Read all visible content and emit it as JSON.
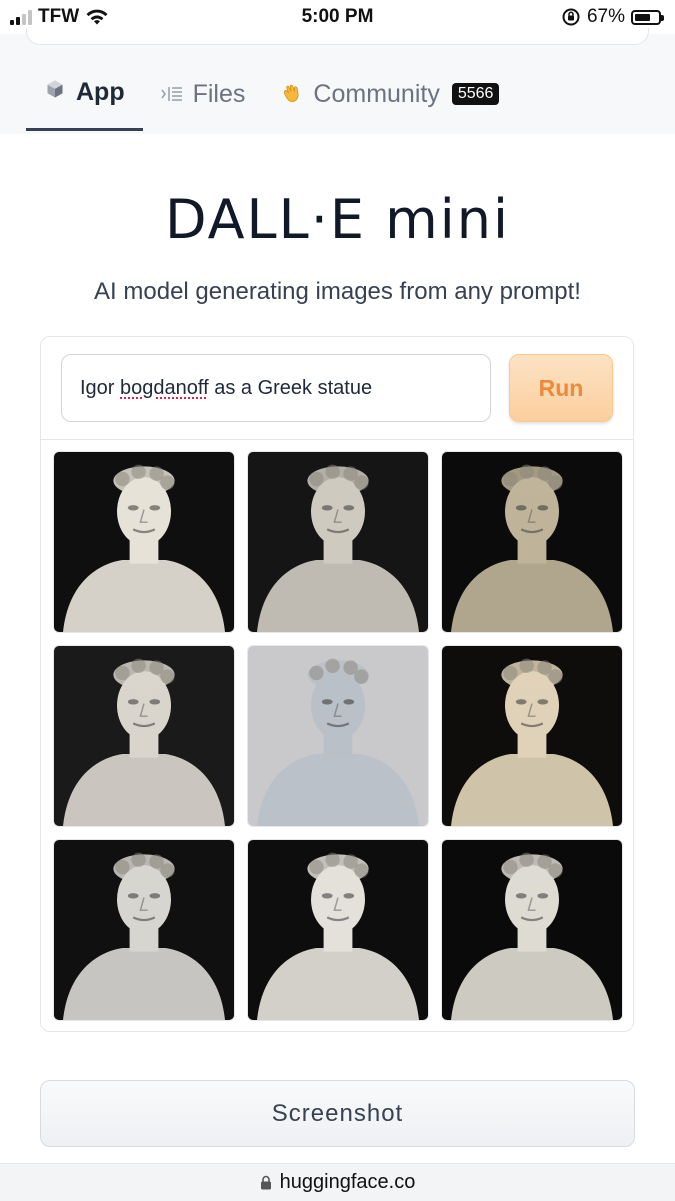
{
  "status_bar": {
    "carrier": "TFW",
    "time": "5:00 PM",
    "battery_percent_label": "67%",
    "battery_level": 0.67
  },
  "tabs": [
    {
      "label": "App",
      "icon": "cube-icon",
      "active": true
    },
    {
      "label": "Files",
      "icon": "files-icon",
      "active": false
    },
    {
      "label": "Community",
      "icon": "wave-hand-icon",
      "active": false,
      "badge": "5566"
    }
  ],
  "header": {
    "title": "DALL·E mini",
    "subtitle": "AI model generating images from any prompt!"
  },
  "prompt": {
    "value_prefix": "Igor ",
    "value_misspelled": "bogdanoff",
    "value_suffix": " as a Greek statue"
  },
  "run_label": "Run",
  "results": {
    "count": 9,
    "images": [
      {
        "bg": "#0f0f0f",
        "stone": "#e6e2d8"
      },
      {
        "bg": "#151515",
        "stone": "#cfcac0"
      },
      {
        "bg": "#0b0b0b",
        "stone": "#bfb49a"
      },
      {
        "bg": "#1a1a1a",
        "stone": "#d9d5cd"
      },
      {
        "bg": "#c9c9cc",
        "stone": "#b9c0c8"
      },
      {
        "bg": "#0e0d0c",
        "stone": "#e0d2b8"
      },
      {
        "bg": "#101010",
        "stone": "#d7d5d0"
      },
      {
        "bg": "#0d0d0d",
        "stone": "#e4e1da"
      },
      {
        "bg": "#0a0a0a",
        "stone": "#dedbd3"
      }
    ]
  },
  "screenshot_label": "Screenshot",
  "url_bar": {
    "domain": "huggingface.co"
  }
}
